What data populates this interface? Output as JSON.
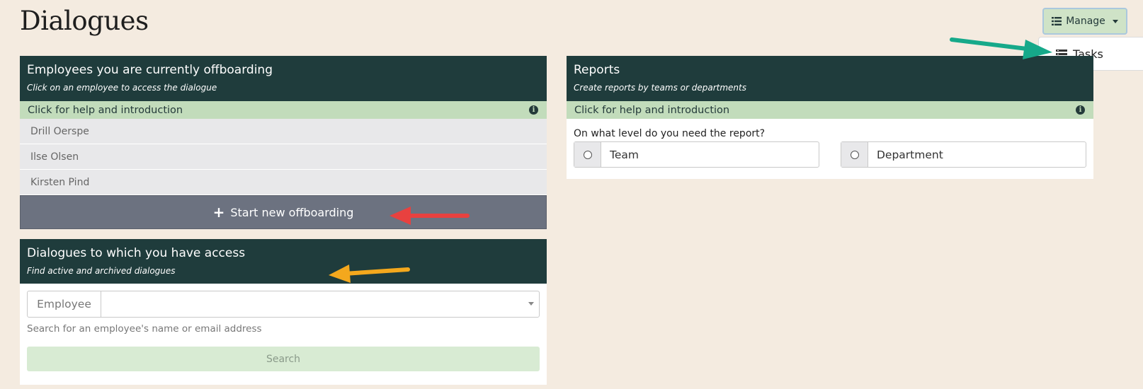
{
  "page": {
    "title": "Dialogues"
  },
  "manage": {
    "label": "Manage",
    "menu_items": [
      {
        "label": "Tasks"
      }
    ]
  },
  "offboarding": {
    "title": "Employees you are currently offboarding",
    "subtitle": "Click on an employee to access the dialogue",
    "help_label": "Click for help and introduction",
    "employees": [
      "Drill Oerspe",
      "Ilse Olsen",
      "Kirsten Pind"
    ],
    "start_button": "Start new offboarding"
  },
  "access": {
    "title": "Dialogues to which you have access",
    "subtitle": "Find active and archived dialogues",
    "employee_addon": "Employee",
    "help_text": "Search for an employee's name or email address",
    "search_button": "Search"
  },
  "reports": {
    "title": "Reports",
    "subtitle": "Create reports by teams or departments",
    "help_label": "Click for help and introduction",
    "level_question": "On what level do you need the report?",
    "options": [
      "Team",
      "Department"
    ]
  },
  "colors": {
    "header": "#1f3c3c",
    "help_bar": "#c2dcbb",
    "background": "#f4ebe0",
    "arrow_red": "#e8413f",
    "arrow_orange": "#f4a81d",
    "arrow_green": "#16a98a"
  }
}
